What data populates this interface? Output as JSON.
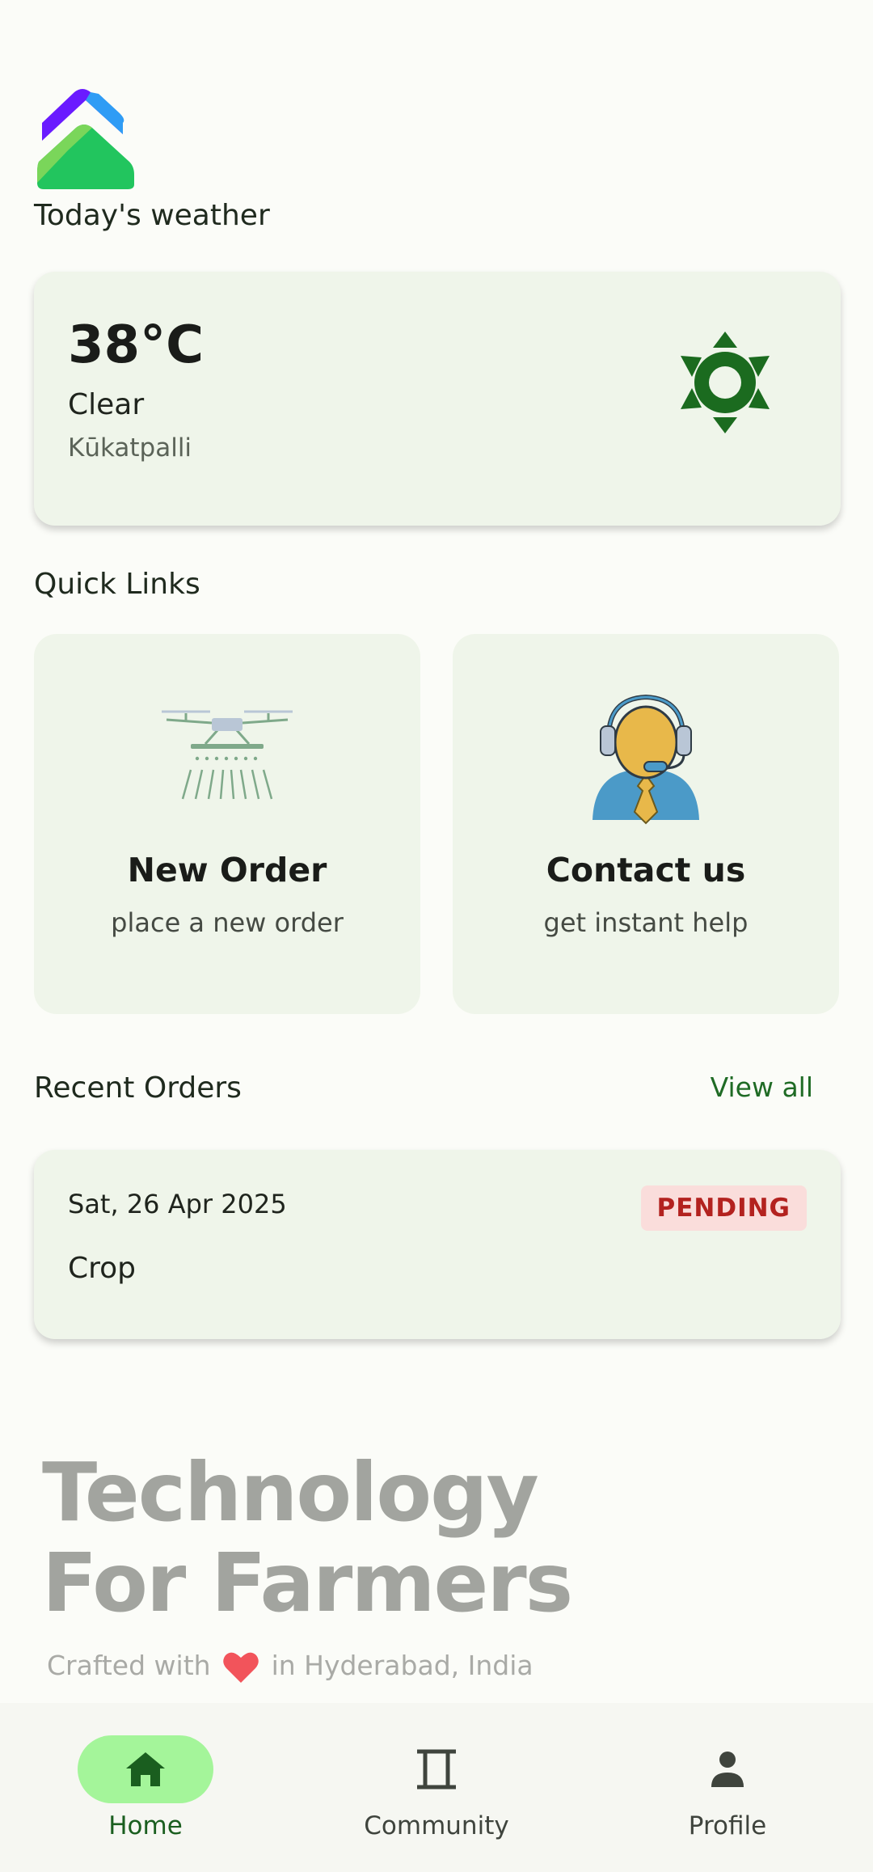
{
  "header": {
    "logo_icon": "app-logo-icon",
    "weather_heading": "Today's weather"
  },
  "weather": {
    "temperature": "38°C",
    "condition": "Clear",
    "location": "Kūkatpalli",
    "icon": "sun-icon",
    "icon_color": "#1b6b1f"
  },
  "quick_links": {
    "title": "Quick Links",
    "items": [
      {
        "title": "New Order",
        "subtitle": "place a new order",
        "icon": "drone-sprayer-icon"
      },
      {
        "title": "Contact us",
        "subtitle": "get instant help",
        "icon": "support-agent-icon"
      }
    ]
  },
  "recent_orders": {
    "title": "Recent Orders",
    "view_all": "View all",
    "orders": [
      {
        "date": "Sat, 26 Apr 2025",
        "name": "Crop",
        "status": "PENDING"
      }
    ]
  },
  "footer": {
    "tagline_line1": "Technology",
    "tagline_line2": "For Farmers",
    "crafted_prefix": "Crafted with",
    "crafted_suffix": "in Hyderabad, India"
  },
  "bottom_nav": {
    "items": [
      {
        "label": "Home",
        "icon": "home-icon",
        "active": true
      },
      {
        "label": "Community",
        "icon": "community-icon",
        "active": false
      },
      {
        "label": "Profile",
        "icon": "person-icon",
        "active": false
      }
    ]
  },
  "colors": {
    "accent_green": "#1f6b25",
    "nav_active_pill": "#a4f59a",
    "card_background": "#eff5ea",
    "status_pending_bg": "#fadddb",
    "status_pending_text": "#b3221f"
  }
}
